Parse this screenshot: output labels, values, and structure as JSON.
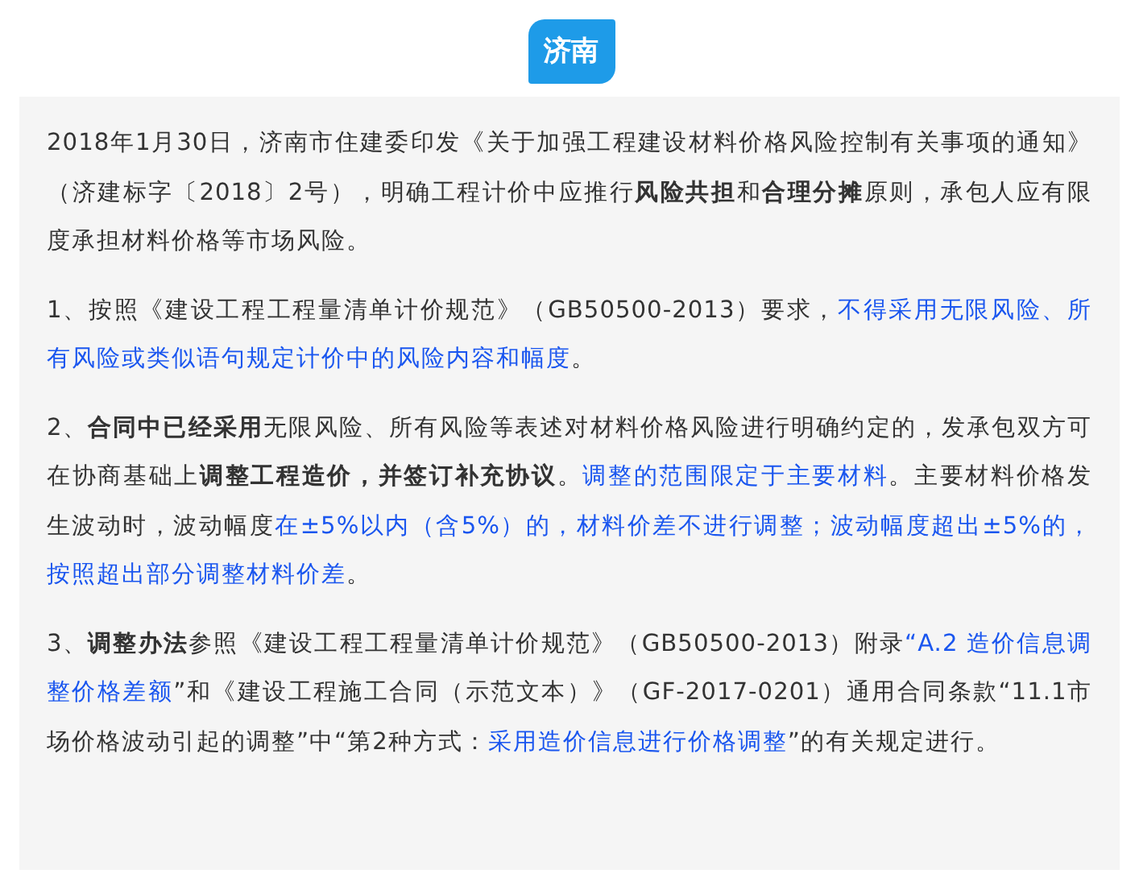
{
  "badge": {
    "label": "济南"
  },
  "paragraphs": [
    {
      "segments": [
        {
          "text": "2018年1月30日，济南市住建委印发《关于加强工程建设材料价格风险控制有关事项的通知》（济建标字〔2018〕2号），明确工程计价中应推行",
          "kind": "plain"
        },
        {
          "text": "风险共担",
          "kind": "strong"
        },
        {
          "text": "和",
          "kind": "plain"
        },
        {
          "text": "合理分摊",
          "kind": "strong"
        },
        {
          "text": "原则，承包人应有限度承担材料价格等市场风险。",
          "kind": "plain"
        }
      ]
    },
    {
      "segments": [
        {
          "text": "1、按照《建设工程工程量清单计价规范》（GB50500-2013）要求，",
          "kind": "plain"
        },
        {
          "text": "不得采用无限风险、所有风险或类似语句规定计价中的风险内容和幅度",
          "kind": "highlight"
        },
        {
          "text": "。",
          "kind": "plain"
        }
      ]
    },
    {
      "segments": [
        {
          "text": "2、",
          "kind": "plain"
        },
        {
          "text": "合同中已经采用",
          "kind": "strong"
        },
        {
          "text": "无限风险、所有风险等表述对材料价格风险进行明确约定的，发承包双方可在协商基础上",
          "kind": "plain"
        },
        {
          "text": "调整工程造价，并签订补充协议",
          "kind": "strong"
        },
        {
          "text": "。",
          "kind": "plain"
        },
        {
          "text": "调整的范围限定于主要材料",
          "kind": "highlight"
        },
        {
          "text": "。主要材料价格发生波动时，波动幅度",
          "kind": "plain"
        },
        {
          "text": "在±5%以内（含5%）的，材料价差不进行调整；波动幅度超出±5%的，按照超出部分调整材料价差",
          "kind": "highlight"
        },
        {
          "text": "。",
          "kind": "plain"
        }
      ]
    },
    {
      "segments": [
        {
          "text": "3、",
          "kind": "plain"
        },
        {
          "text": "调整办法",
          "kind": "strong"
        },
        {
          "text": "参照《建设工程工程量清单计价规范》（GB50500-2013）附录",
          "kind": "plain"
        },
        {
          "text": "“A.2 造价信息调整价格差额",
          "kind": "highlight"
        },
        {
          "text": "”和《建设工程施工合同（示范文本）》（GF-2017-0201）通用合同条款“11.1市场价格波动引起的调整”中“第2种方式：",
          "kind": "plain"
        },
        {
          "text": "采用造价信息进行价格调整",
          "kind": "highlight"
        },
        {
          "text": "”的有关规定进行。",
          "kind": "plain"
        }
      ]
    }
  ]
}
